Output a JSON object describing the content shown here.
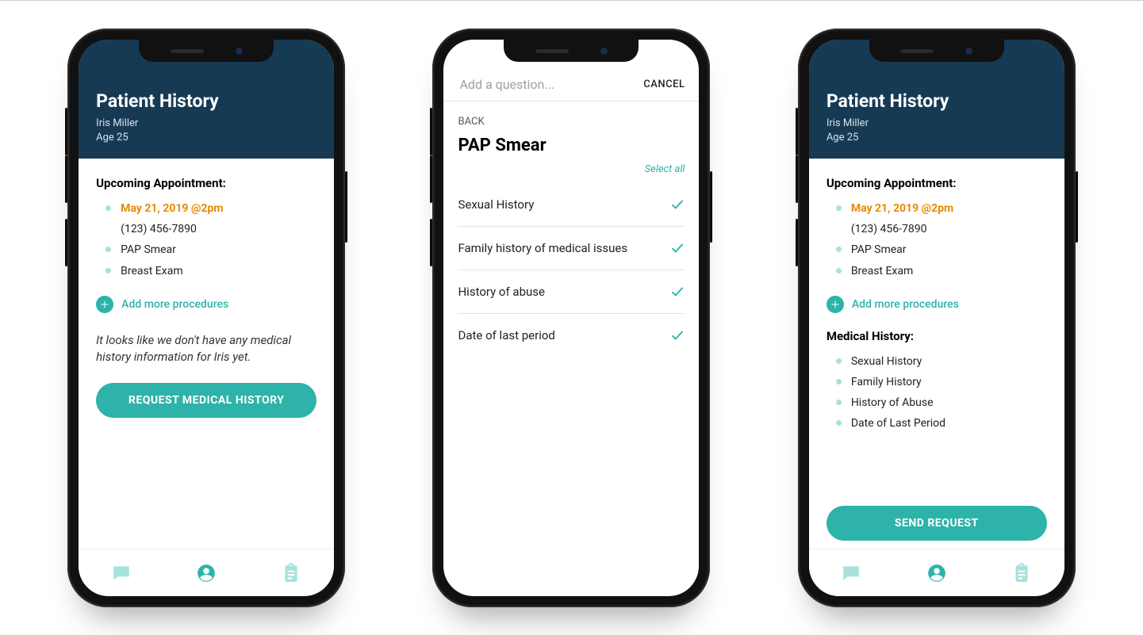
{
  "colors": {
    "teal": "#2db3a9",
    "teal_light": "#a7e1dc",
    "navy": "#173a54",
    "orange": "#e68a00"
  },
  "screen1": {
    "title": "Patient History",
    "patient_name": "Iris Miller",
    "patient_age": "Age 25",
    "upcoming_label": "Upcoming Appointment:",
    "appt_date": "May 21, 2019 @2pm",
    "appt_phone": "(123) 456-7890",
    "procedures": [
      "PAP Smear",
      "Breast Exam"
    ],
    "add_more_label": "Add more procedures",
    "empty_msg": "It looks like we don't have any medical history information for Iris yet.",
    "cta": "REQUEST MEDICAL HISTORY"
  },
  "screen2": {
    "placeholder": "Add a question...",
    "cancel": "CANCEL",
    "back": "BACK",
    "title": "PAP Smear",
    "select_all": "Select all",
    "items": [
      "Sexual History",
      "Family history of medical issues",
      "History of abuse",
      "Date of last period"
    ]
  },
  "screen3": {
    "title": "Patient History",
    "patient_name": "Iris Miller",
    "patient_age": "Age 25",
    "upcoming_label": "Upcoming Appointment:",
    "appt_date": "May 21, 2019 @2pm",
    "appt_phone": "(123) 456-7890",
    "procedures": [
      "PAP Smear",
      "Breast Exam"
    ],
    "add_more_label": "Add more procedures",
    "medical_label": "Medical History:",
    "medical_items": [
      "Sexual History",
      "Family History",
      "History of Abuse",
      "Date of Last Period"
    ],
    "cta": "SEND REQUEST"
  },
  "tabs": {
    "chat": "chat-icon",
    "profile": "profile-icon",
    "clipboard": "clipboard-icon"
  }
}
